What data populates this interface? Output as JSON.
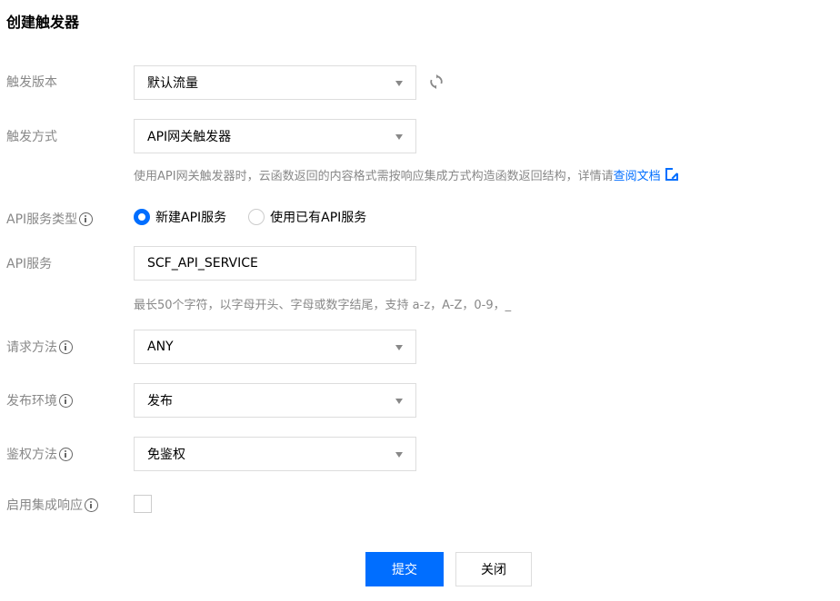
{
  "page": {
    "title": "创建触发器"
  },
  "trigger_version": {
    "label": "触发版本",
    "value": "默认流量"
  },
  "trigger_method": {
    "label": "触发方式",
    "value": "API网关触发器",
    "hint_text": "使用API网关触发器时，云函数返回的内容格式需按响应集成方式构造函数返回结构，详情请",
    "hint_link": "查阅文档"
  },
  "api_service_type": {
    "label": "API服务类型",
    "options": [
      {
        "label": "新建API服务",
        "selected": true
      },
      {
        "label": "使用已有API服务",
        "selected": false
      }
    ]
  },
  "api_service": {
    "label": "API服务",
    "value": "SCF_API_SERVICE",
    "hint": "最长50个字符，以字母开头、字母或数字结尾，支持 a-z，A-Z，0-9，_"
  },
  "request_method": {
    "label": "请求方法",
    "value": "ANY"
  },
  "publish_env": {
    "label": "发布环境",
    "value": "发布"
  },
  "auth_method": {
    "label": "鉴权方法",
    "value": "免鉴权"
  },
  "integration_response": {
    "label": "启用集成响应",
    "checked": false
  },
  "buttons": {
    "submit": "提交",
    "close": "关闭"
  },
  "colors": {
    "accent": "#006eff",
    "label": "#888888",
    "border": "#dddddd"
  },
  "icons": {
    "refresh": "refresh-icon",
    "external_link": "external-link-icon",
    "info": "info-icon",
    "caret": "caret-down-icon"
  }
}
